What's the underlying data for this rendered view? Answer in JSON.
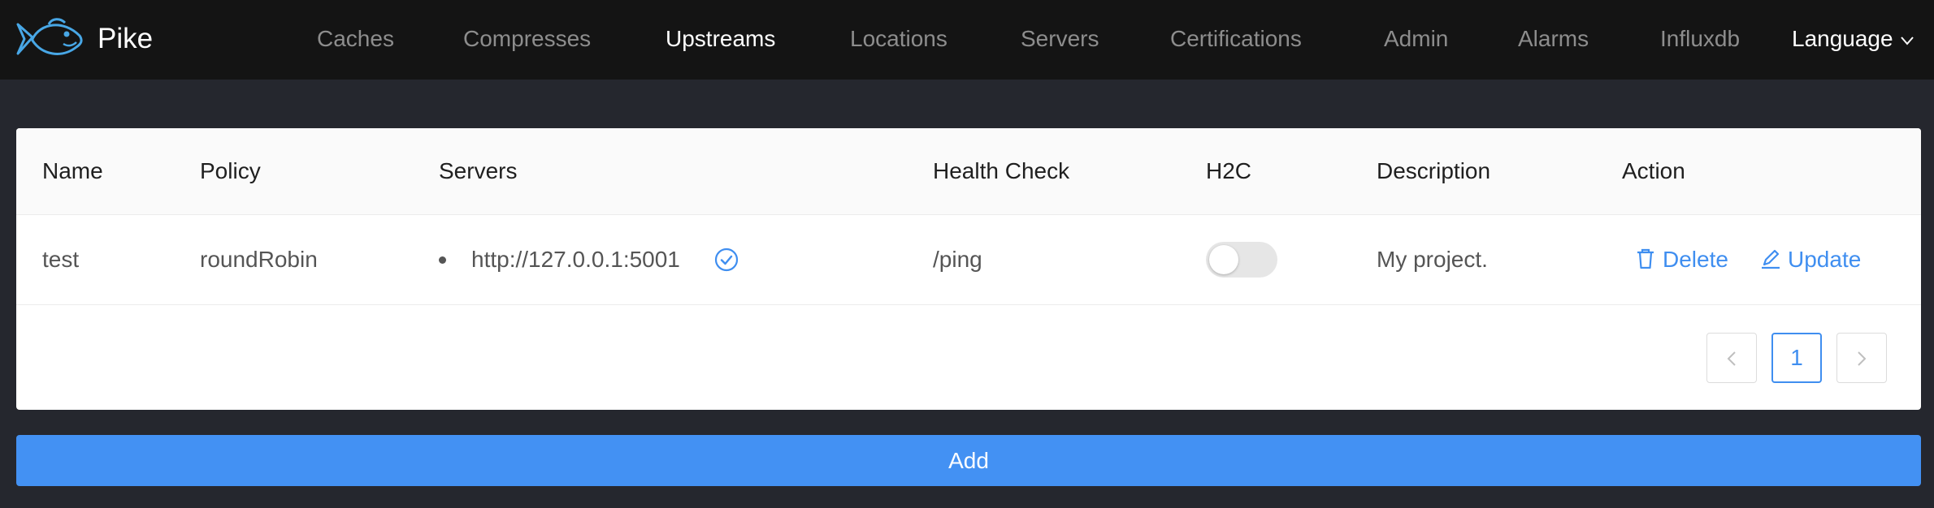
{
  "app": {
    "name": "Pike",
    "accent_color": "#3f8ef0",
    "header_bg": "#141414",
    "page_bg": "#25272e"
  },
  "nav": {
    "items": [
      {
        "label": "Caches",
        "active": false
      },
      {
        "label": "Compresses",
        "active": false
      },
      {
        "label": "Upstreams",
        "active": true
      },
      {
        "label": "Locations",
        "active": false
      },
      {
        "label": "Servers",
        "active": false
      },
      {
        "label": "Certifications",
        "active": false
      },
      {
        "label": "Admin",
        "active": false
      },
      {
        "label": "Alarms",
        "active": false
      },
      {
        "label": "Influxdb",
        "active": false
      }
    ],
    "language_label": "Language"
  },
  "table": {
    "columns": [
      "Name",
      "Policy",
      "Servers",
      "Health Check",
      "H2C",
      "Description",
      "Action"
    ],
    "rows": [
      {
        "name": "test",
        "policy": "roundRobin",
        "servers": [
          "http://127.0.0.1:5001"
        ],
        "server_status_icon": "check-circle-icon",
        "health_check": "/ping",
        "h2c": false,
        "description": "My project.",
        "actions": {
          "delete": "Delete",
          "update": "Update"
        }
      }
    ]
  },
  "pagination": {
    "current_page": "1"
  },
  "add_button_label": "Add"
}
